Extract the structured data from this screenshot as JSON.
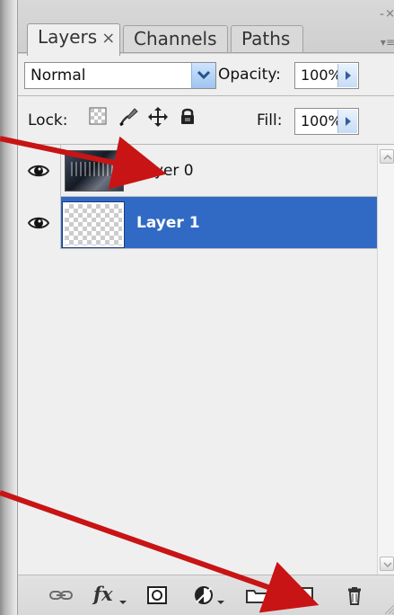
{
  "panel": {
    "tabs": [
      {
        "label": "Layers",
        "close_glyph": "×",
        "active": true
      },
      {
        "label": "Channels",
        "active": false
      },
      {
        "label": "Paths",
        "active": false
      }
    ],
    "window_controls": {
      "minimize": "-",
      "close": "×",
      "menu": "▾≡"
    }
  },
  "blend": {
    "mode": "Normal",
    "opacity_label": "Opacity:",
    "opacity_value": "100%"
  },
  "lock_fill": {
    "lock_label": "Lock:",
    "fill_label": "Fill:",
    "fill_value": "100%",
    "lock_icons": [
      "lock-transparency-icon",
      "lock-paint-icon",
      "lock-position-icon",
      "lock-all-icon"
    ]
  },
  "layers": [
    {
      "name": "Layer 0",
      "visible": true,
      "selected": false,
      "thumbnail": "photo"
    },
    {
      "name": "Layer 1",
      "visible": true,
      "selected": true,
      "thumbnail": "transparent"
    }
  ],
  "bottom_toolbar": {
    "buttons": [
      {
        "name": "link-layers-icon"
      },
      {
        "name": "layer-style-icon",
        "label": "fx"
      },
      {
        "name": "layer-mask-icon"
      },
      {
        "name": "adjustment-layer-icon"
      },
      {
        "name": "new-group-icon"
      },
      {
        "name": "new-layer-icon"
      },
      {
        "name": "delete-layer-icon"
      }
    ]
  },
  "colors": {
    "panel_bg": "#efefef",
    "selected_row": "#316ac5",
    "annotation_red": "#c81414"
  }
}
